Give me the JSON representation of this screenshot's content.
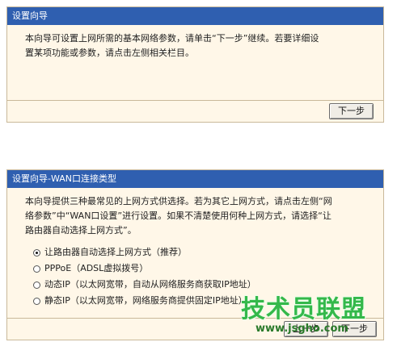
{
  "wizard1": {
    "title": "设置向导",
    "line1": "本向导可设置上网所需的基本网络参数，请单击“下一步”继续。若要详细设",
    "line2": "置某项功能或参数，请点击左侧相关栏目。",
    "next_label": "下一步"
  },
  "wizard2": {
    "title": "设置向导-WAN口连接类型",
    "line1": "本向导提供三种最常见的上网方式供选择。若为其它上网方式，请点击左侧“网",
    "line2": "络参数”中“WAN口设置”进行设置。如果不清楚使用何种上网方式，请选择“让",
    "line3": "路由器自动选择上网方式”。",
    "options": [
      {
        "label": "让路由器自动选择上网方式（推荐）",
        "selected": true
      },
      {
        "label": "PPPoE（ADSL虚拟拨号）",
        "selected": false
      },
      {
        "label": "动态IP（以太网宽带，自动从网络服务商获取IP地址）",
        "selected": false
      },
      {
        "label": "静态IP（以太网宽带，网络服务商提供固定IP地址）",
        "selected": false
      }
    ],
    "prev_label": "上一步",
    "next_label": "下一步"
  },
  "watermark": {
    "text": "技术员联盟",
    "url": "www.jsgho.com"
  }
}
